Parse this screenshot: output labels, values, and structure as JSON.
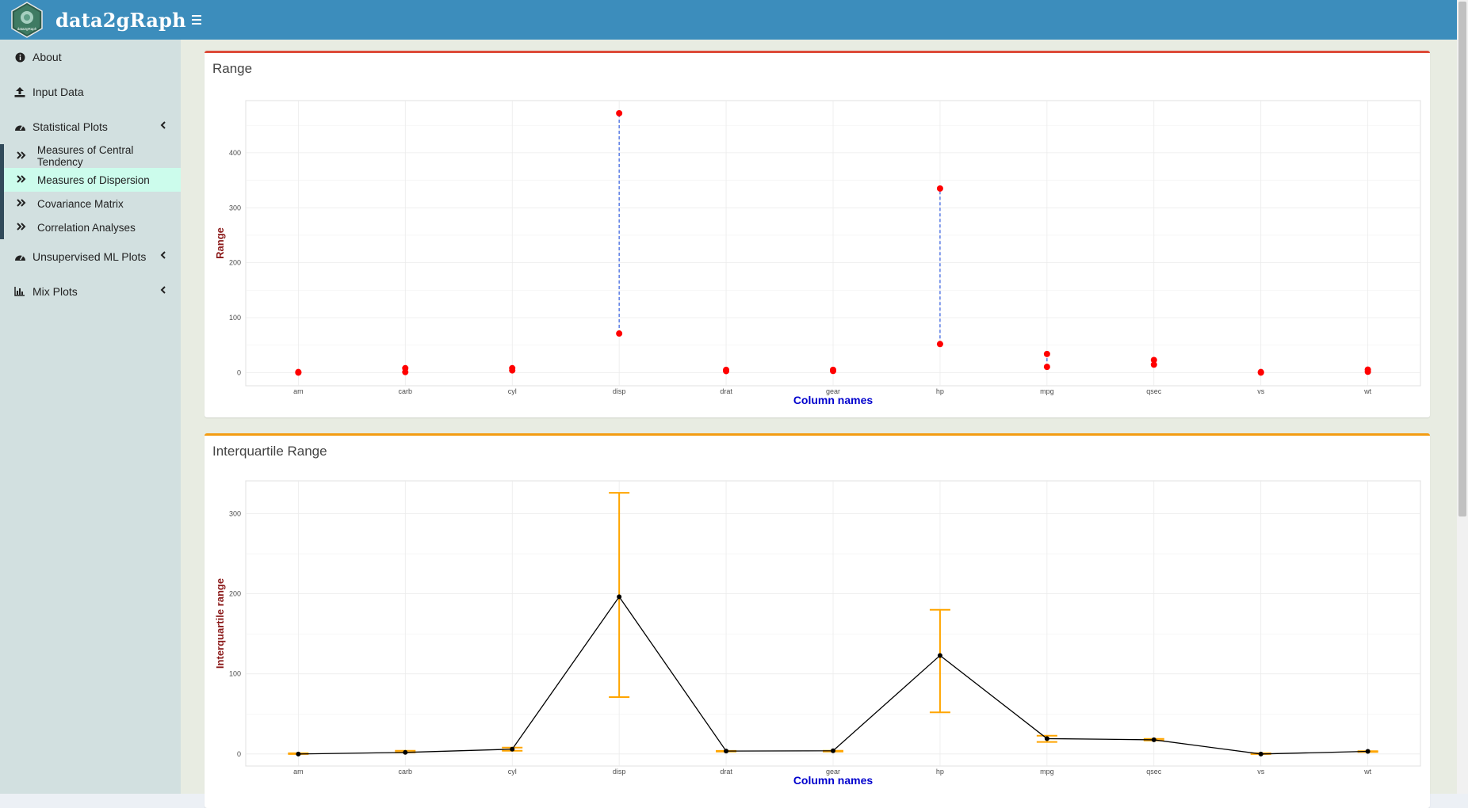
{
  "app": {
    "title": "data2gRaph",
    "logo_text": "data2gRaph"
  },
  "sidebar": {
    "items": [
      {
        "label": "About",
        "icon": "info-circle-icon"
      },
      {
        "label": "Input Data",
        "icon": "upload-icon"
      },
      {
        "label": "Statistical Plots",
        "icon": "dashboard-icon"
      },
      {
        "label": "Unsupervised ML Plots",
        "icon": "dashboard-icon"
      },
      {
        "label": "Mix Plots",
        "icon": "bar-chart-icon"
      }
    ],
    "statistical_sub": [
      {
        "label": "Measures of Central Tendency",
        "icon": "double-chevron-right-icon"
      },
      {
        "label": "Measures of Dispersion",
        "icon": "double-chevron-right-icon",
        "active": true
      },
      {
        "label": "Covariance Matrix",
        "icon": "double-chevron-right-icon"
      },
      {
        "label": "Correlation Analyses",
        "icon": "double-chevron-right-icon"
      }
    ]
  },
  "boxes": {
    "range_title": "Range",
    "iqr_title": "Interquartile Range",
    "range_color": "#dd4b39",
    "iqr_color": "#f39c12"
  },
  "chart_data": [
    {
      "type": "scatter",
      "title": "",
      "xlabel": "Column names",
      "ylabel": "Range",
      "categories": [
        "am",
        "carb",
        "cyl",
        "disp",
        "drat",
        "gear",
        "hp",
        "mpg",
        "qsec",
        "vs",
        "wt"
      ],
      "min": [
        0,
        1,
        4,
        71.1,
        2.76,
        3,
        52,
        10.4,
        14.5,
        0,
        1.51
      ],
      "max": [
        1,
        8,
        8,
        472,
        4.93,
        5,
        335,
        33.9,
        22.9,
        1,
        5.42
      ],
      "ylim": [
        -24,
        495
      ],
      "yticks": [
        0,
        100,
        200,
        300,
        400
      ],
      "grid": true,
      "point_color": "#ff0000",
      "segment_color": "#4169e1"
    },
    {
      "type": "line",
      "title": "",
      "xlabel": "Column names",
      "ylabel": "Interquartile range",
      "categories": [
        "am",
        "carb",
        "cyl",
        "disp",
        "drat",
        "gear",
        "hp",
        "mpg",
        "qsec",
        "vs",
        "wt"
      ],
      "median": [
        0,
        2,
        6,
        196.3,
        3.7,
        4,
        123,
        19.2,
        17.7,
        0,
        3.3
      ],
      "q1": [
        0,
        2,
        4,
        71,
        3.1,
        3,
        52,
        15,
        16.9,
        0,
        2.6
      ],
      "q3": [
        1,
        4,
        8,
        326,
        3.9,
        4,
        180,
        22.8,
        18.9,
        1,
        3.6
      ],
      "ylim": [
        -15,
        341
      ],
      "yticks": [
        0,
        100,
        200,
        300
      ],
      "grid": true,
      "line_color": "#000000",
      "errorbar_color": "#ffa500"
    }
  ]
}
